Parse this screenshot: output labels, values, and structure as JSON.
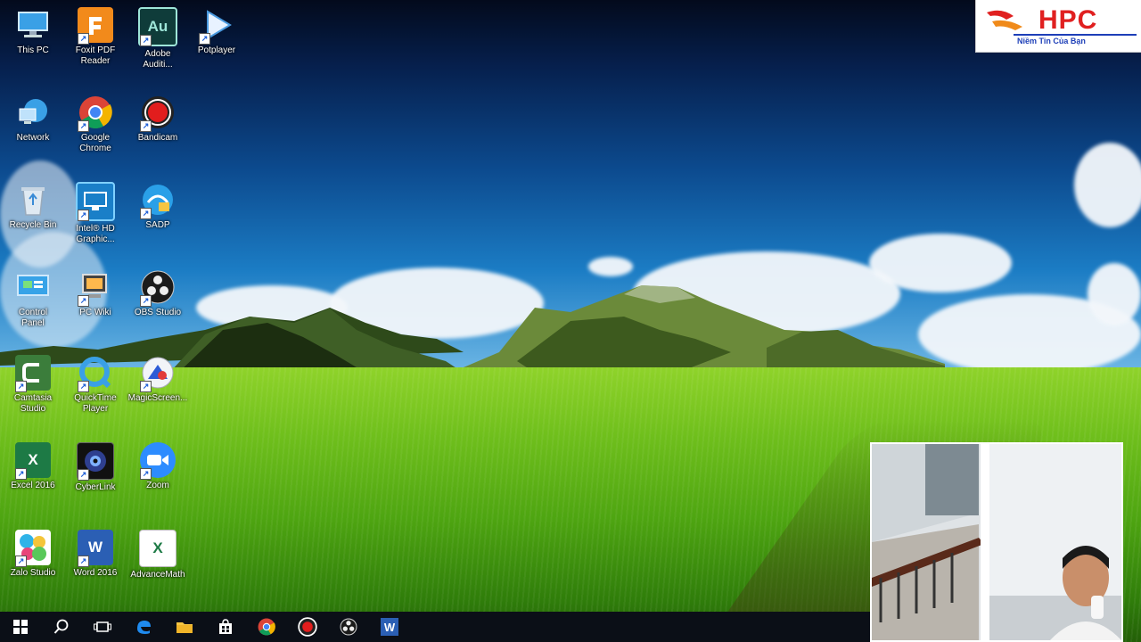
{
  "desktop": {
    "icons": [
      {
        "label": "This PC",
        "icon": "this-pc-icon"
      },
      {
        "label": "Foxit PDF\nReader",
        "icon": "foxit-reader-icon"
      },
      {
        "label": "Adobe\nAuditi...",
        "icon": "adobe-audition-icon",
        "glyph_text": "Au"
      },
      {
        "label": "Potplayer",
        "icon": "potplayer-icon"
      },
      {
        "label": "Network",
        "icon": "network-icon"
      },
      {
        "label": "Google\nChrome",
        "icon": "chrome-icon"
      },
      {
        "label": "Bandicam",
        "icon": "bandicam-icon"
      },
      {
        "label": "Recycle Bin",
        "icon": "recycle-bin-icon"
      },
      {
        "label": "Intel® HD\nGraphic...",
        "icon": "intel-graphics-icon"
      },
      {
        "label": "SADP",
        "icon": "sadp-icon"
      },
      {
        "label": "Control\nPanel",
        "icon": "control-panel-icon"
      },
      {
        "label": "PC Wiki",
        "icon": "pc-wiki-icon"
      },
      {
        "label": "OBS Studio",
        "icon": "obs-icon"
      },
      {
        "label": "Camtasia\nStudio",
        "icon": "camtasia-icon"
      },
      {
        "label": "QuickTime\nPlayer",
        "icon": "quicktime-icon"
      },
      {
        "label": "MagicScreen...",
        "icon": "magicscreen-icon"
      },
      {
        "label": "Excel 2016",
        "icon": "excel-icon",
        "glyph_text": "X"
      },
      {
        "label": "CyberLink",
        "icon": "webcam-app-icon"
      },
      {
        "label": "Zoom",
        "icon": "zoom-icon"
      },
      {
        "label": "Zalo Studio",
        "icon": "zalo-studio-icon"
      },
      {
        "label": "Word 2016",
        "icon": "word-icon",
        "glyph_text": "W"
      },
      {
        "label": "AdvanceMath",
        "icon": "excel-file-icon",
        "glyph_text": "X"
      }
    ]
  },
  "logo": {
    "brand": "HPC",
    "slogan": "Niềm Tin Của Bạn"
  },
  "taskbar": {
    "items": [
      {
        "name": "start-button",
        "icon": "windows-icon"
      },
      {
        "name": "search-button",
        "icon": "search-icon"
      },
      {
        "name": "task-view-button",
        "icon": "task-view-icon"
      },
      {
        "name": "edge-button",
        "icon": "edge-icon"
      },
      {
        "name": "file-explorer-button",
        "icon": "folder-icon"
      },
      {
        "name": "store-button",
        "icon": "store-icon"
      },
      {
        "name": "chrome-taskbar-button",
        "icon": "chrome-icon"
      },
      {
        "name": "bandicam-taskbar-button",
        "icon": "bandicam-icon"
      },
      {
        "name": "obs-taskbar-button",
        "icon": "obs-icon"
      },
      {
        "name": "word-taskbar-button",
        "icon": "word-icon"
      }
    ]
  },
  "colors": {
    "excel": "#1d7a45",
    "word": "#2b5fb4",
    "audition": "#0f3c3a",
    "foxit": "#f28a1b",
    "zoom": "#2d8cff",
    "hpc_red": "#e02020",
    "hpc_blue": "#1d3fb8"
  }
}
